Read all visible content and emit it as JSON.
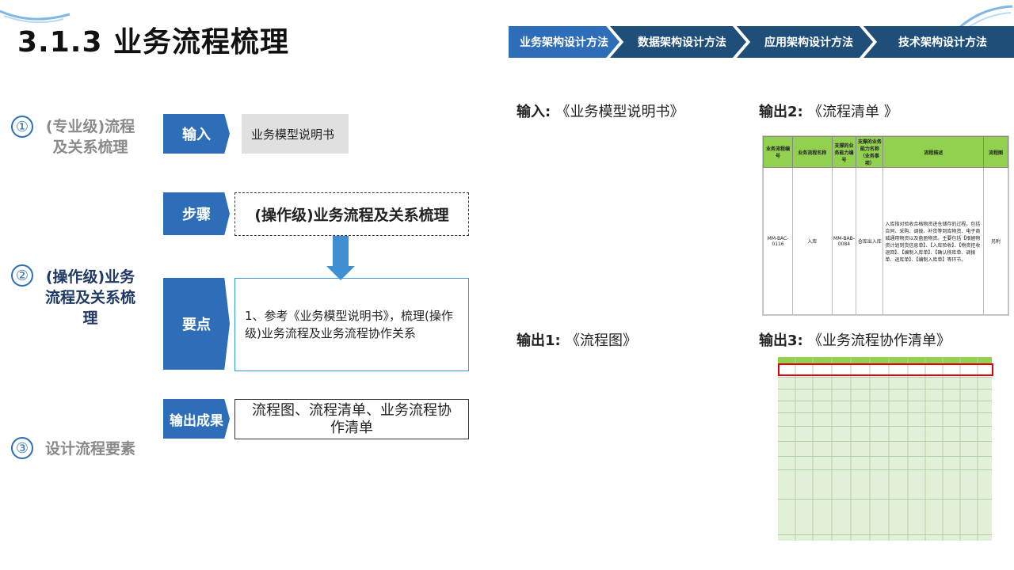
{
  "page": {
    "title": "3.1.3 业务流程梳理"
  },
  "nav": {
    "items": [
      "业务架构设计方法",
      "数据架构设计方法",
      "应用架构设计方法",
      "技术架构设计方法"
    ],
    "active_color": "#2e6eb8",
    "inactive_color": "#1f4e79"
  },
  "steps": [
    {
      "num": "①",
      "label": "(专业级)流程及关系梳理"
    },
    {
      "num": "②",
      "label": "(操作级)业务流程及关系梳理"
    },
    {
      "num": "③",
      "label": "设计流程要素"
    }
  ],
  "flow": {
    "input_tag": "输入",
    "input_text": "业务模型说明书",
    "step_tag": "步骤",
    "step_text": "(操作级)业务流程及关系梳理",
    "key_tag": "要点",
    "key_text": "1、参考《业务模型说明书》，梳理(操作级)业务流程及业务流程协作关系",
    "output_tag": "输出成果",
    "output_text": "流程图、流程清单、业务流程协作清单"
  },
  "io": {
    "input_label": "输入:",
    "input_value": "《业务模型说明书》",
    "output2_label": "输出2:",
    "output2_value": "《流程清单 》",
    "output1_label": "输出1:",
    "output1_value": "《流程图》",
    "output3_label": "输出3:",
    "output3_value": "《业务流程协作清单》"
  },
  "flow_list_table": {
    "headers": [
      "业务流程编号",
      "业务流程名称",
      "支撑的业务能力编号",
      "支撑的业务能力名称（业务事项）",
      "流程描述",
      "流程图"
    ],
    "row": [
      "MM-BAC-0116",
      "入库",
      "MM-BAB-0084",
      "仓库出入库",
      "入库指对验收合格物资进仓储存的过程。包括合同、采购、调拨、补货等到库物资、电子商城通用物资以及盘盈物资。主要包括【根据物资计划到货信息单】、【入库验收】、【物资拒收退回】、【编制入库单】、【确认移库单、调拨单、退库单】、【编制入库单】等环节。",
      "另附"
    ]
  }
}
